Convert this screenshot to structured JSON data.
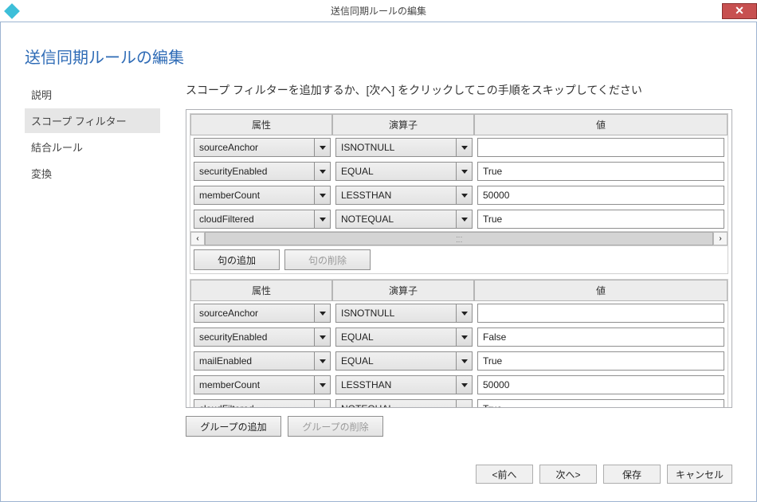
{
  "window": {
    "title": "送信同期ルールの編集"
  },
  "page": {
    "heading": "送信同期ルールの編集",
    "instruction": "スコープ フィルターを追加するか、[次へ] をクリックしてこの手順をスキップしてください"
  },
  "sidebar": {
    "items": [
      {
        "label": "説明"
      },
      {
        "label": "スコープ フィルター"
      },
      {
        "label": "結合ルール"
      },
      {
        "label": "変換"
      }
    ],
    "selected_index": 1
  },
  "grid_headers": {
    "attribute": "属性",
    "operator": "演算子",
    "value": "値"
  },
  "groups": [
    {
      "has_hscroll": true,
      "has_clause_buttons": true,
      "rows": [
        {
          "attribute": "sourceAnchor",
          "operator": "ISNOTNULL",
          "value": ""
        },
        {
          "attribute": "securityEnabled",
          "operator": "EQUAL",
          "value": "True"
        },
        {
          "attribute": "memberCount",
          "operator": "LESSTHAN",
          "value": "50000"
        },
        {
          "attribute": "cloudFiltered",
          "operator": "NOTEQUAL",
          "value": "True"
        }
      ]
    },
    {
      "has_hscroll": false,
      "has_clause_buttons": false,
      "rows": [
        {
          "attribute": "sourceAnchor",
          "operator": "ISNOTNULL",
          "value": ""
        },
        {
          "attribute": "securityEnabled",
          "operator": "EQUAL",
          "value": "False"
        },
        {
          "attribute": "mailEnabled",
          "operator": "EQUAL",
          "value": "True"
        },
        {
          "attribute": "memberCount",
          "operator": "LESSTHAN",
          "value": "50000"
        },
        {
          "attribute": "cloudFiltered",
          "operator": "NOTEQUAL",
          "value": "True"
        }
      ]
    }
  ],
  "buttons": {
    "add_clause": "句の追加",
    "remove_clause": "句の削除",
    "add_group": "グループの追加",
    "remove_group": "グループの削除",
    "prev": "<前へ",
    "next": "次へ>",
    "save": "保存",
    "cancel": "キャンセル"
  }
}
